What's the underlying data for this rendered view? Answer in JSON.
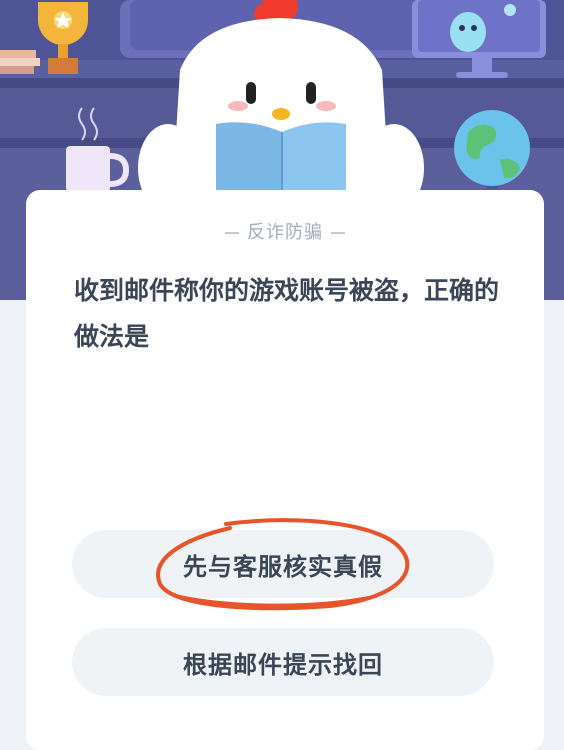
{
  "quiz": {
    "category": "反诈防骗",
    "question": "收到邮件称你的游戏账号被盗，正确的做法是",
    "options": [
      {
        "label": "先与客服核实真假",
        "marked": true
      },
      {
        "label": "根据邮件提示找回",
        "marked": false
      }
    ]
  },
  "colors": {
    "banner_bg": "#5a5fa0",
    "card_bg": "#ffffff",
    "option_bg": "#eff3f5",
    "annotation": "#e8542a"
  },
  "icons": [
    "trophy-icon",
    "chicken-mascot",
    "book-icon",
    "mug-icon",
    "alien-monitor-icon",
    "globe-icon",
    "books-stack-icon"
  ]
}
